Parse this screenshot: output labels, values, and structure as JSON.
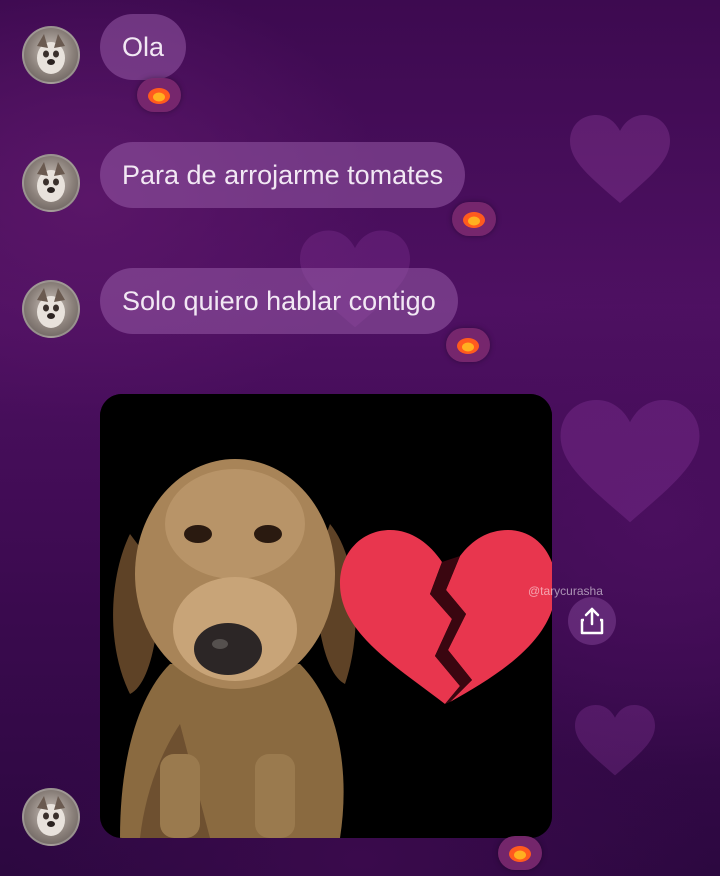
{
  "messages": [
    {
      "text": "Ola",
      "reaction": "fire-emoji"
    },
    {
      "text": "Para de arrojarme tomates",
      "reaction": "fire-emoji"
    },
    {
      "text": "Solo quiero hablar contigo",
      "reaction": "fire-emoji"
    }
  ],
  "media_message": {
    "content": "dachshund with broken heart sticker",
    "watermark": "@tarycurasha",
    "reaction": "fire-emoji"
  },
  "share_button": {
    "icon": "share-icon"
  },
  "colors": {
    "bubble": "#965aa5",
    "background": "#4e1062",
    "heart_red": "#e8364e",
    "reaction_bg": "#782870"
  }
}
